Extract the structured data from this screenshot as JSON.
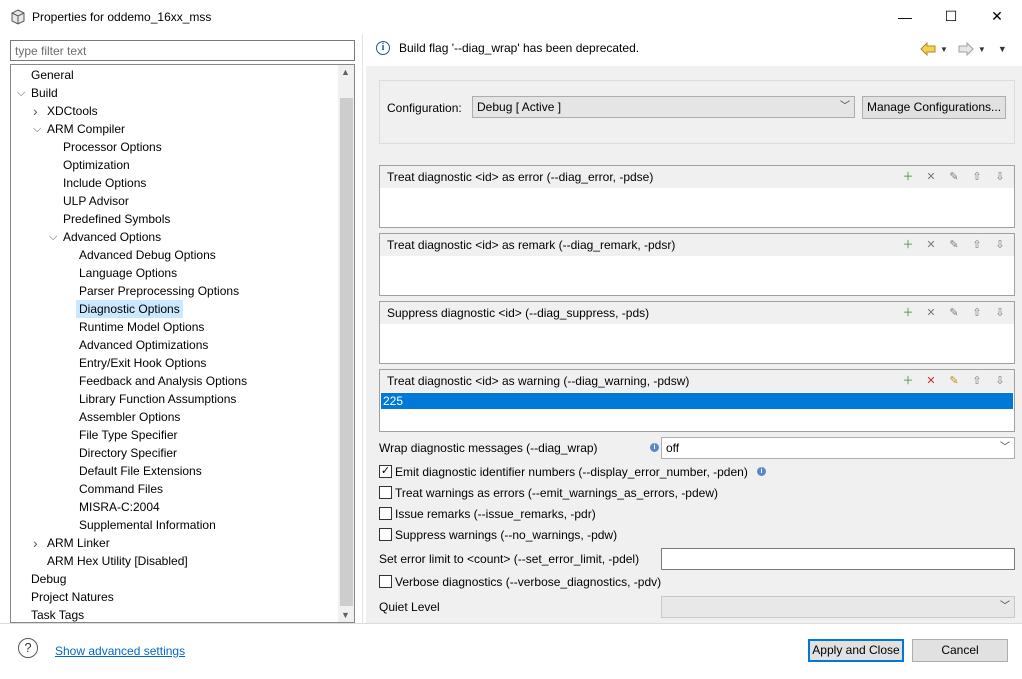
{
  "window": {
    "title": "Properties for oddemo_16xx_mss",
    "minimize_glyph": "—",
    "maximize_glyph": "☐",
    "close_glyph": "✕"
  },
  "filter": {
    "placeholder": "type filter text"
  },
  "tree": [
    {
      "label": "General",
      "level": 0,
      "twisty": ""
    },
    {
      "label": "Build",
      "level": 0,
      "twisty": "v"
    },
    {
      "label": "XDCtools",
      "level": 1,
      "twisty": ">"
    },
    {
      "label": "ARM Compiler",
      "level": 1,
      "twisty": "v"
    },
    {
      "label": "Processor Options",
      "level": 2,
      "twisty": ""
    },
    {
      "label": "Optimization",
      "level": 2,
      "twisty": ""
    },
    {
      "label": "Include Options",
      "level": 2,
      "twisty": ""
    },
    {
      "label": "ULP Advisor",
      "level": 2,
      "twisty": ""
    },
    {
      "label": "Predefined Symbols",
      "level": 2,
      "twisty": ""
    },
    {
      "label": "Advanced Options",
      "level": 2,
      "twisty": "v"
    },
    {
      "label": "Advanced Debug Options",
      "level": 3,
      "twisty": ""
    },
    {
      "label": "Language Options",
      "level": 3,
      "twisty": ""
    },
    {
      "label": "Parser Preprocessing Options",
      "level": 3,
      "twisty": ""
    },
    {
      "label": "Diagnostic Options",
      "level": 3,
      "twisty": "",
      "selected": true
    },
    {
      "label": "Runtime Model Options",
      "level": 3,
      "twisty": ""
    },
    {
      "label": "Advanced Optimizations",
      "level": 3,
      "twisty": ""
    },
    {
      "label": "Entry/Exit Hook Options",
      "level": 3,
      "twisty": ""
    },
    {
      "label": "Feedback and Analysis Options",
      "level": 3,
      "twisty": ""
    },
    {
      "label": "Library Function Assumptions",
      "level": 3,
      "twisty": ""
    },
    {
      "label": "Assembler Options",
      "level": 3,
      "twisty": ""
    },
    {
      "label": "File Type Specifier",
      "level": 3,
      "twisty": ""
    },
    {
      "label": "Directory Specifier",
      "level": 3,
      "twisty": ""
    },
    {
      "label": "Default File Extensions",
      "level": 3,
      "twisty": ""
    },
    {
      "label": "Command Files",
      "level": 3,
      "twisty": ""
    },
    {
      "label": "MISRA-C:2004",
      "level": 3,
      "twisty": ""
    },
    {
      "label": "Supplemental Information",
      "level": 3,
      "twisty": ""
    },
    {
      "label": "ARM Linker",
      "level": 1,
      "twisty": ">"
    },
    {
      "label": "ARM Hex Utility  [Disabled]",
      "level": 1,
      "twisty": ""
    },
    {
      "label": "Debug",
      "level": 0,
      "twisty": ""
    },
    {
      "label": "Project Natures",
      "level": 0,
      "twisty": ""
    },
    {
      "label": "Task Tags",
      "level": 0,
      "twisty": ""
    }
  ],
  "message": {
    "text": "Build flag '--diag_wrap' has been deprecated."
  },
  "config": {
    "label": "Configuration:",
    "value": "Debug  [ Active ]",
    "manage_button": "Manage Configurations..."
  },
  "lists": [
    {
      "title": "Treat diagnostic <id> as error (--diag_error, -pdse)",
      "items": []
    },
    {
      "title": "Treat diagnostic <id> as remark (--diag_remark, -pdsr)",
      "items": []
    },
    {
      "title": "Suppress diagnostic <id> (--diag_suppress, -pds)",
      "items": []
    },
    {
      "title": "Treat diagnostic <id> as warning (--diag_warning, -pdsw)",
      "items": [
        "225"
      ]
    }
  ],
  "options": {
    "wrap_label": "Wrap diagnostic messages (--diag_wrap)",
    "wrap_value": "off",
    "emit_label": "Emit diagnostic identifier numbers (--display_error_number, -pden)",
    "emit_checked": true,
    "warnings_errors_label": "Treat warnings as errors (--emit_warnings_as_errors, -pdew)",
    "warnings_errors_checked": false,
    "issue_remarks_label": "Issue remarks (--issue_remarks, -pdr)",
    "issue_remarks_checked": false,
    "suppress_warnings_label": "Suppress warnings (--no_warnings, -pdw)",
    "suppress_warnings_checked": false,
    "error_limit_label": "Set error limit to <count> (--set_error_limit, -pdel)",
    "error_limit_value": "",
    "verbose_label": "Verbose diagnostics (--verbose_diagnostics, -pdv)",
    "verbose_checked": false,
    "quiet_label": "Quiet Level",
    "quiet_value": ""
  },
  "footer": {
    "advanced_link": "Show advanced settings",
    "apply_close": "Apply and Close",
    "cancel": "Cancel"
  }
}
